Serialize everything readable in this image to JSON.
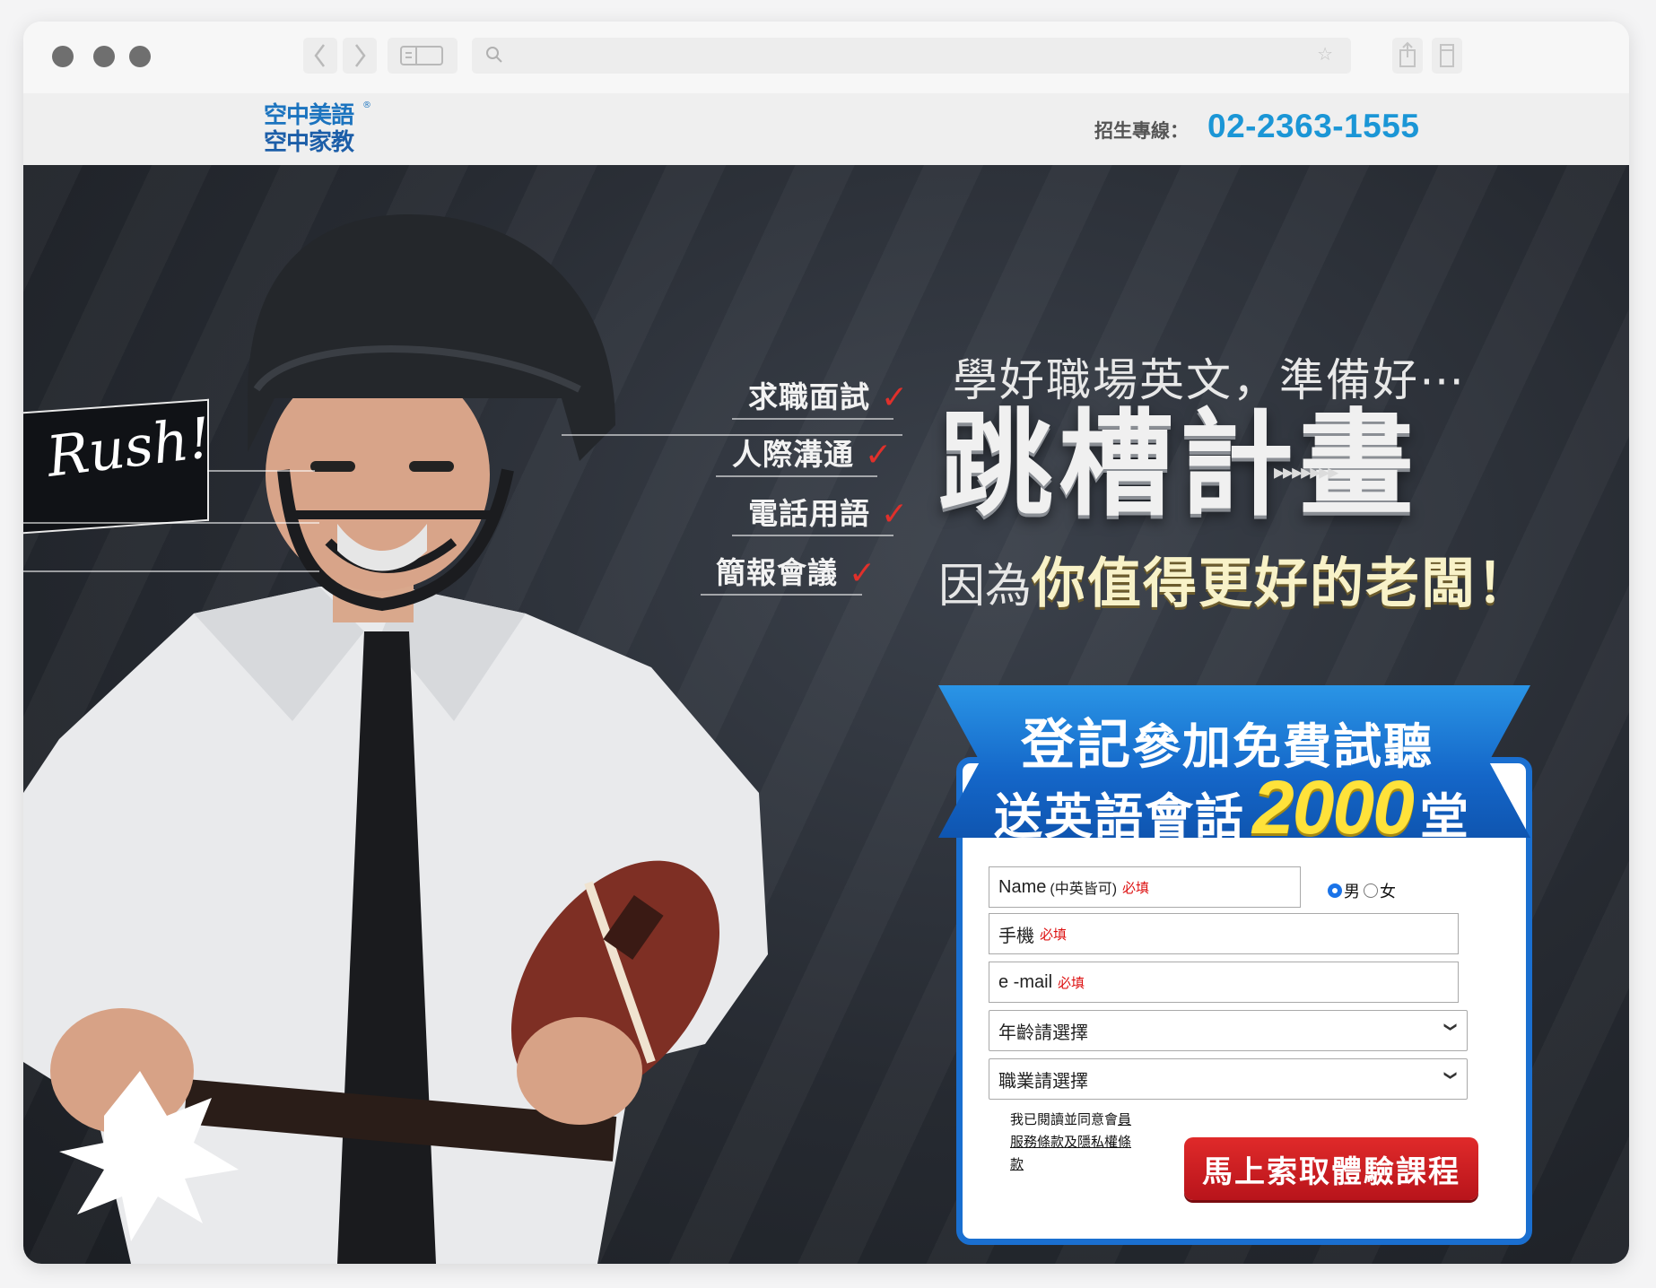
{
  "browser": {
    "window_controls": [
      "close",
      "minimize",
      "zoom"
    ],
    "back_icon": "chevron-left-icon",
    "forward_icon": "chevron-right-icon",
    "sidebar_icon": "sidebar-icon",
    "search_icon": "search-icon",
    "bookmark_icon": "star-icon",
    "share_icon": "share-icon",
    "tabs_icon": "tabs-icon"
  },
  "header": {
    "logo_line1": "空中美語",
    "logo_line2": "空中家教",
    "logo_mark": "®",
    "hotline_label": "招生專線：",
    "hotline_number": "02-2363-1555"
  },
  "hero": {
    "rush": "Rush!",
    "skills": [
      {
        "label": "求職面試",
        "check": "✓"
      },
      {
        "label": "人際溝通",
        "check": "✓"
      },
      {
        "label": "電話用語",
        "check": "✓"
      },
      {
        "label": "簡報會議",
        "check": "✓"
      }
    ],
    "subtitle": "學好職場英文，準備好⋯",
    "title": "跳槽計畫",
    "title_arrows": "▸▸▸▸▸▸▸",
    "tagline_prefix": "因為",
    "tagline_main": "你值得更好的老闆！"
  },
  "signup": {
    "banner_line1_big": "登記",
    "banner_line1_rest": "參加免費試聽",
    "banner_line2_pre": "送英語會話",
    "banner_count": "2000",
    "banner_unit": "堂",
    "name_placeholder": "Name",
    "name_note": "(中英皆可)",
    "required": "必填",
    "gender_male": "男",
    "gender_female": "女",
    "gender_selected": "男",
    "phone_placeholder": "手機",
    "email_placeholder": "e -mail",
    "age_select": "年齡請選擇",
    "job_select": "職業請選擇",
    "terms_text": "我已閱讀並同意會",
    "terms_link": "員服務條款及隱私權條款",
    "submit_label": "馬上索取體驗課程"
  },
  "colors": {
    "brand_blue": "#1c74bf",
    "hotline_blue": "#1b96d6",
    "banner_blue": "#1466c8",
    "submit_red": "#c8181e",
    "count_yellow": "#ffe23a"
  }
}
